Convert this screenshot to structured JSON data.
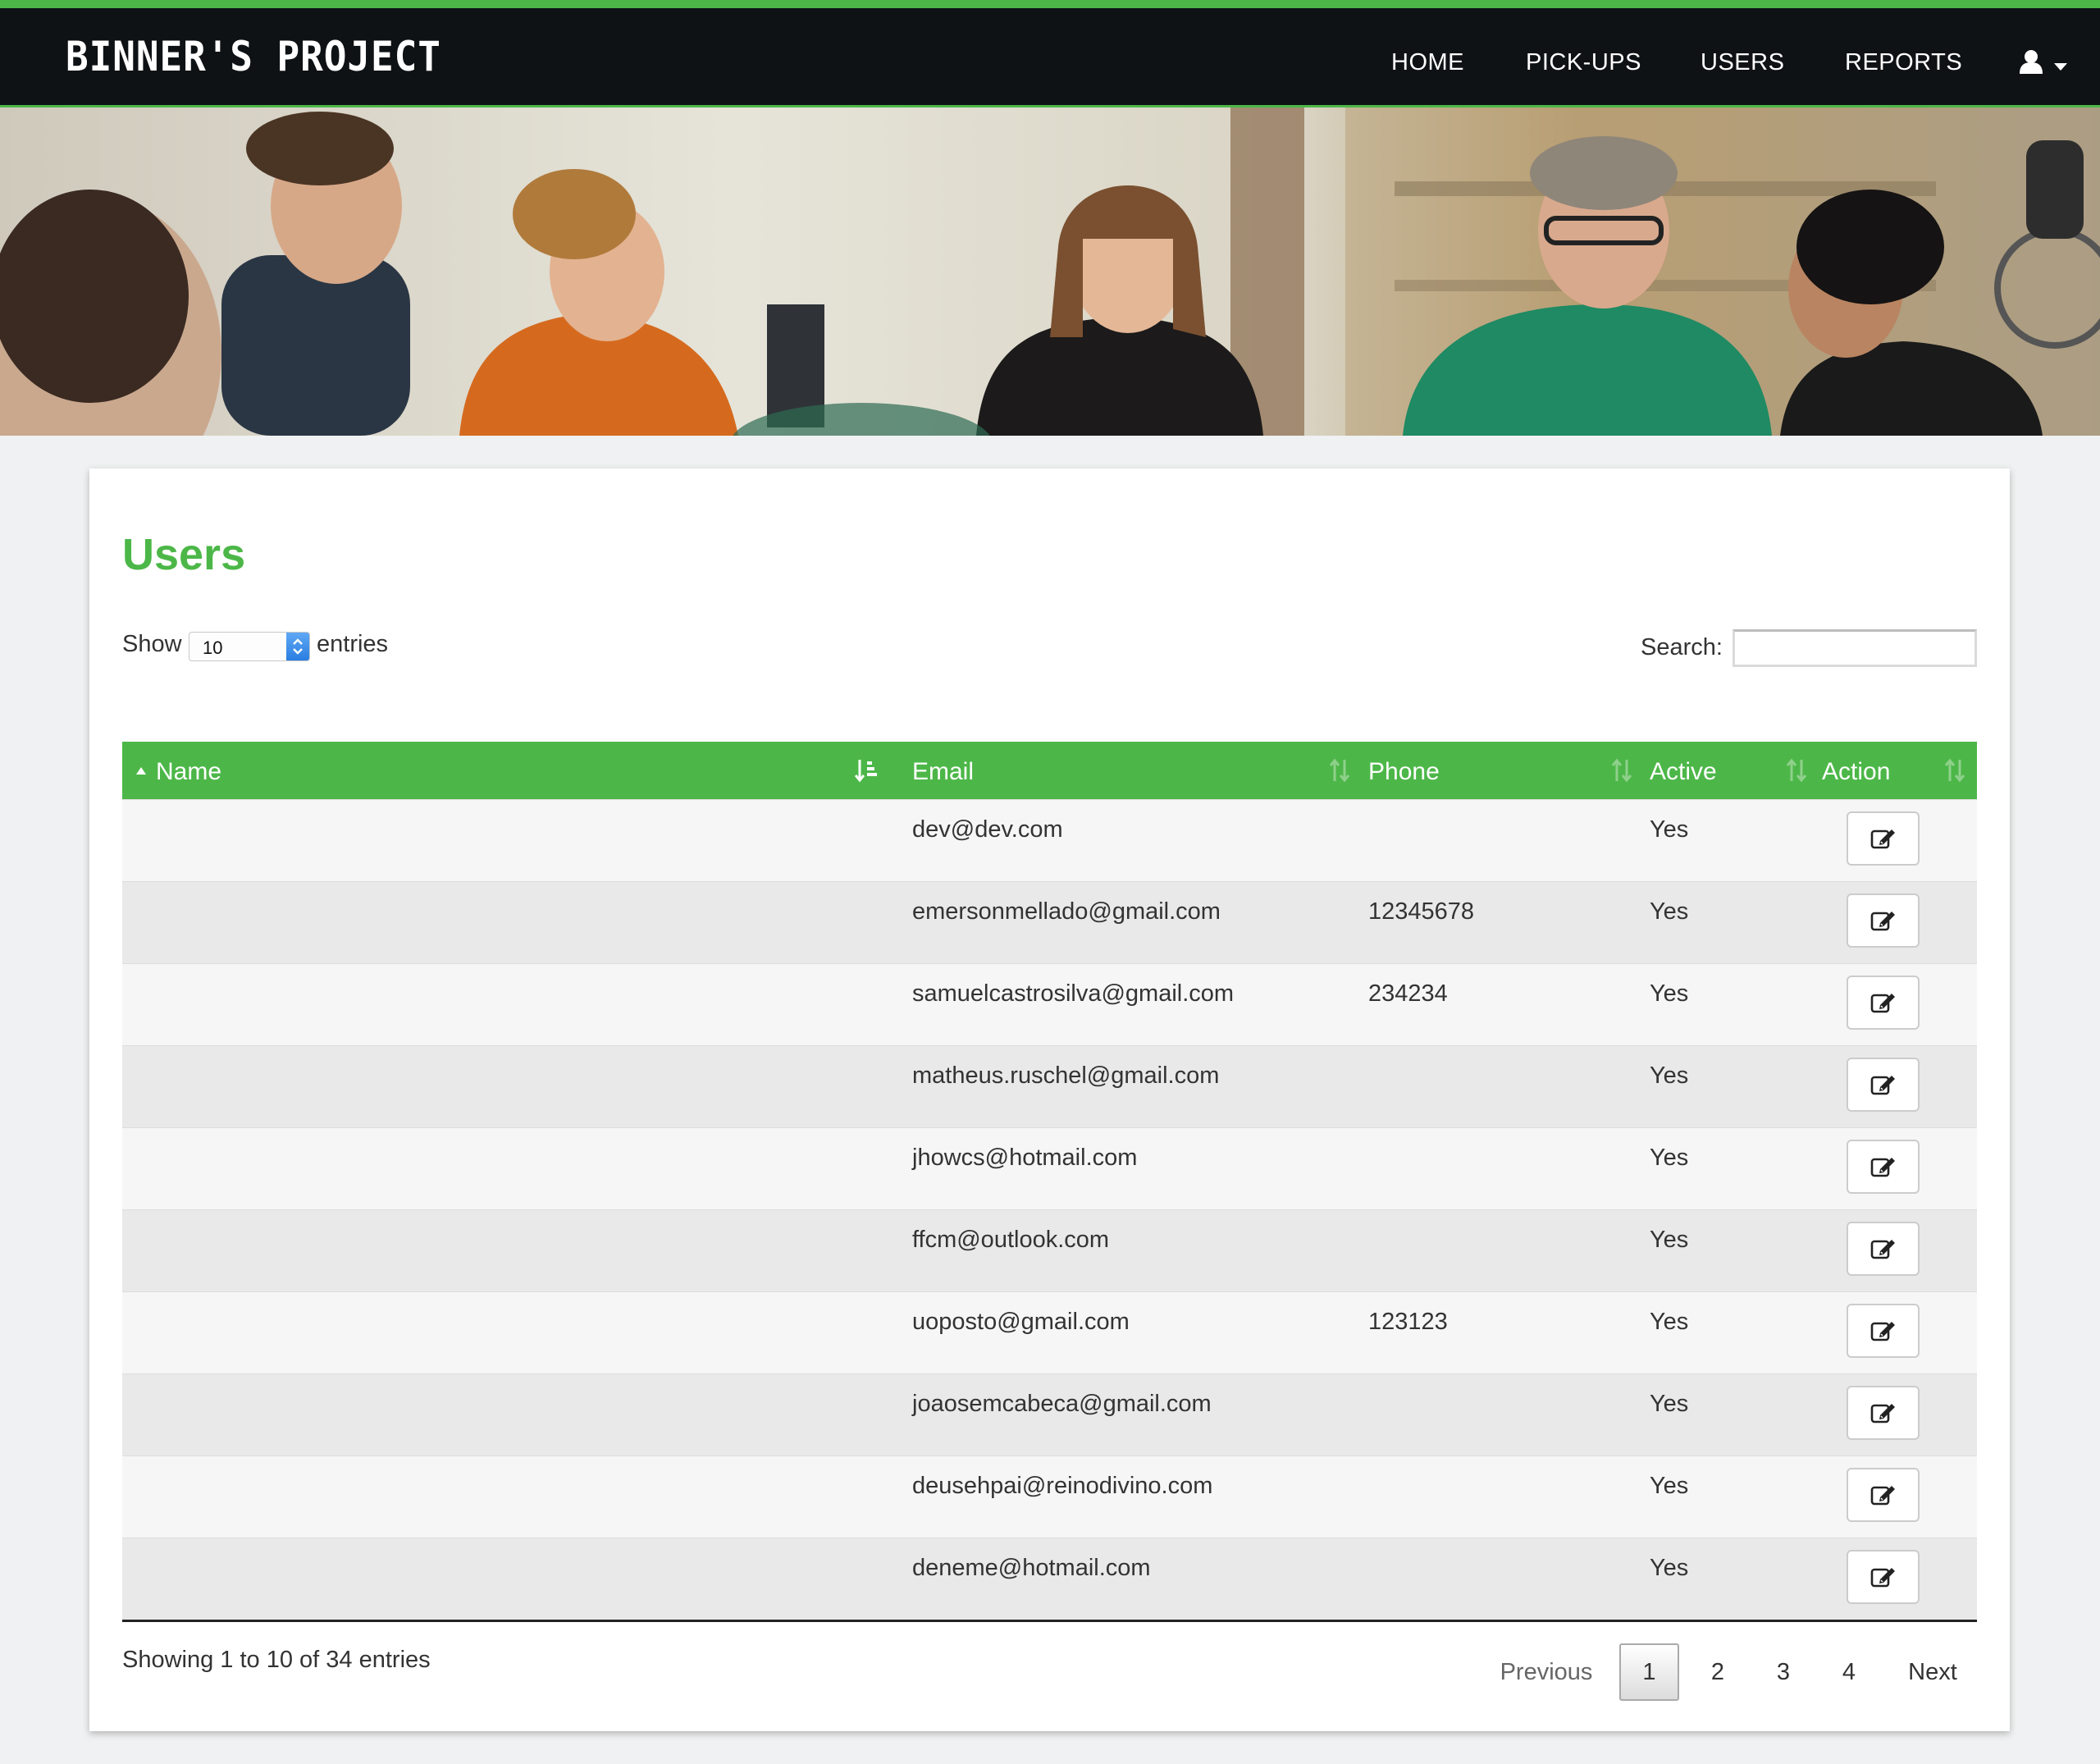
{
  "navbar": {
    "brand": "BINNER'S PROJECT",
    "items": [
      {
        "label": "HOME"
      },
      {
        "label": "PICK-UPS"
      },
      {
        "label": "USERS"
      },
      {
        "label": "REPORTS"
      }
    ],
    "user_menu_icon": "user-icon",
    "accent_color": "#4cb748",
    "background_color": "#0f1215"
  },
  "hero": {
    "image": "group photo of volunteers seated in a workshop"
  },
  "page": {
    "title": "Users",
    "length": {
      "show_label": "Show",
      "selected": "10",
      "entries_label": "entries"
    },
    "search": {
      "label": "Search:",
      "value": "",
      "placeholder": ""
    }
  },
  "table": {
    "header_color": "#4cb748",
    "columns": [
      {
        "label": "Name",
        "sort": "ascending"
      },
      {
        "label": "Email",
        "sort": "none"
      },
      {
        "label": "Phone",
        "sort": "none"
      },
      {
        "label": "Active",
        "sort": "none"
      },
      {
        "label": "Action",
        "sort": "none"
      }
    ],
    "rows": [
      {
        "name": "",
        "email": "dev@dev.com",
        "phone": "",
        "active": "Yes"
      },
      {
        "name": "",
        "email": "emersonmellado@gmail.com",
        "phone": "12345678",
        "active": "Yes"
      },
      {
        "name": "",
        "email": "samuelcastrosilva@gmail.com",
        "phone": "234234",
        "active": "Yes"
      },
      {
        "name": "",
        "email": "matheus.ruschel@gmail.com",
        "phone": "",
        "active": "Yes"
      },
      {
        "name": "",
        "email": "jhowcs@hotmail.com",
        "phone": "",
        "active": "Yes"
      },
      {
        "name": "",
        "email": "ffcm@outlook.com",
        "phone": "",
        "active": "Yes"
      },
      {
        "name": "",
        "email": "uoposto@gmail.com",
        "phone": "123123",
        "active": "Yes"
      },
      {
        "name": "",
        "email": "joaosemcabeca@gmail.com",
        "phone": "",
        "active": "Yes"
      },
      {
        "name": "",
        "email": "deusehpai@reinodivino.com",
        "phone": "",
        "active": "Yes"
      },
      {
        "name": "",
        "email": "deneme@hotmail.com",
        "phone": "",
        "active": "Yes"
      }
    ],
    "action_icon": "edit-icon"
  },
  "footer": {
    "info": "Showing 1 to 10 of 34 entries",
    "pagination": {
      "previous": "Previous",
      "pages": [
        "1",
        "2",
        "3",
        "4"
      ],
      "current": "1",
      "next": "Next"
    }
  }
}
